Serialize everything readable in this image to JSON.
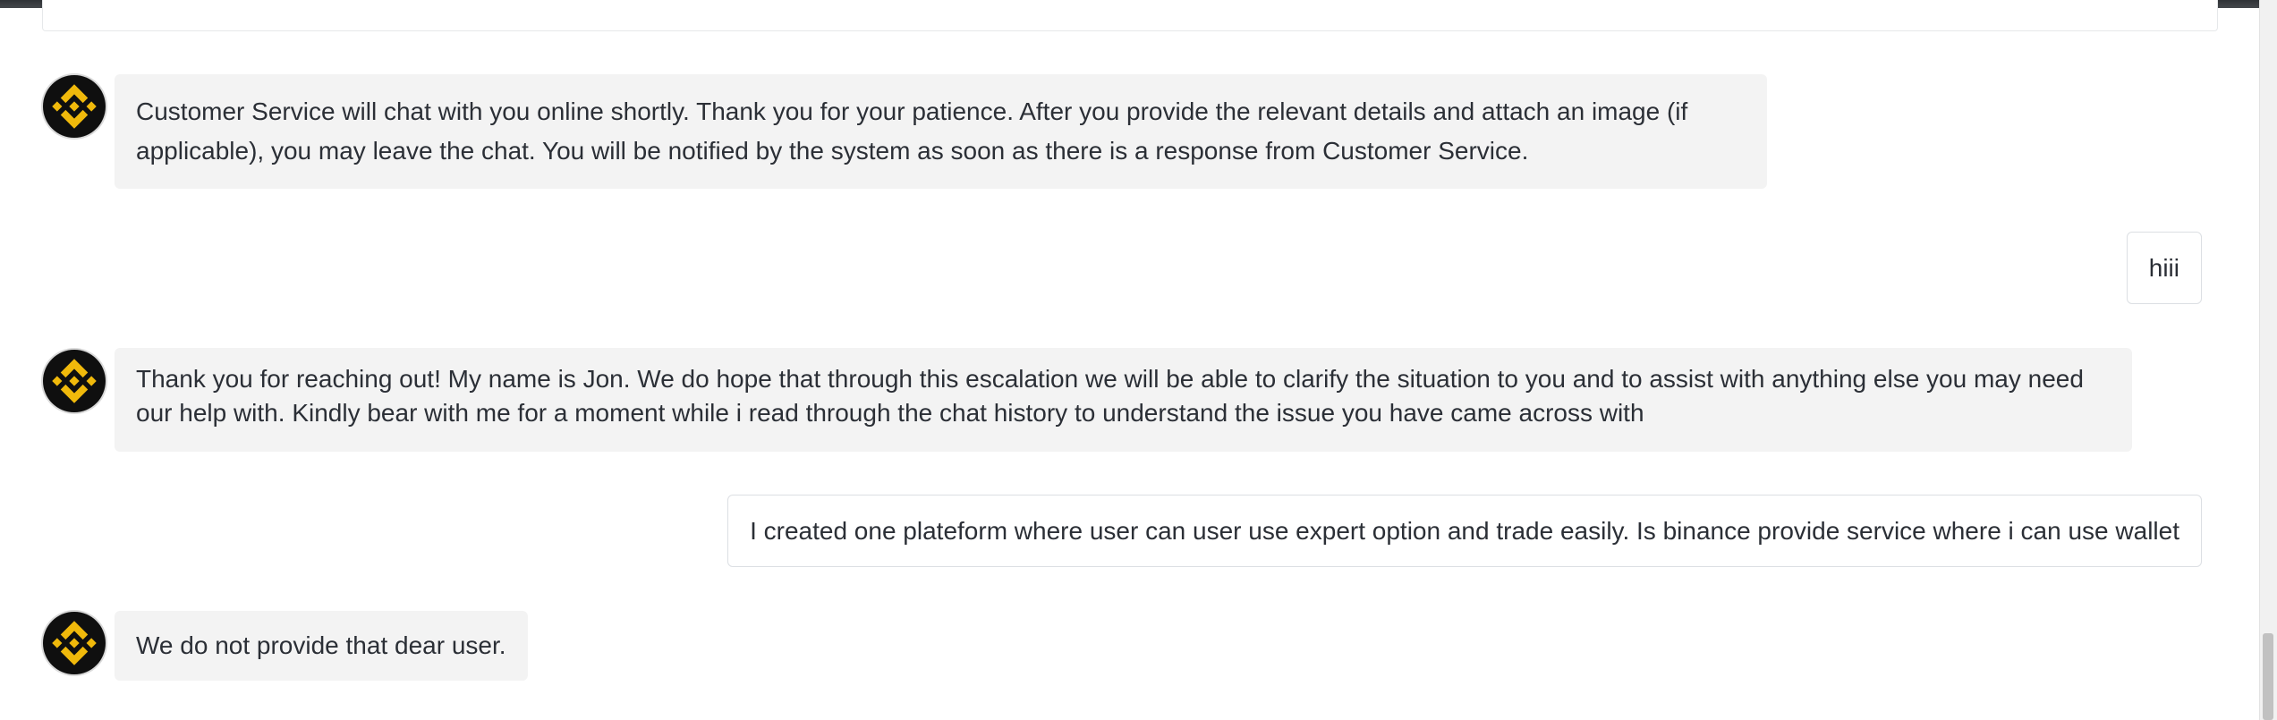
{
  "chat": {
    "messages": [
      {
        "role": "agent",
        "avatar_icon": "binance-logo-icon",
        "text": "Customer Service will chat with you online shortly. Thank you for your patience. After you provide the relevant details and attach an image (if applicable), you may leave the chat. You will be notified by the system as soon as there is a response from Customer Service."
      },
      {
        "role": "user",
        "text": "hiii"
      },
      {
        "role": "agent",
        "avatar_icon": "binance-logo-icon",
        "text": "Thank you for reaching out! My name is Jon. We do hope that through this escalation we will be able to clarify the situation to you and to assist with anything else you may need our help with. Kindly bear with me for a moment while i read through the chat history to understand the issue you have came across with"
      },
      {
        "role": "user",
        "text": "I created one plateform where user can user use expert option and trade easily. Is binance provide service where i can use wallet"
      },
      {
        "role": "agent",
        "avatar_icon": "binance-logo-icon",
        "text": "We do not provide that dear user."
      }
    ]
  },
  "colors": {
    "brand_gold": "#F0B90B",
    "agent_bubble": "#F3F3F3",
    "text": "#2B2F36"
  }
}
